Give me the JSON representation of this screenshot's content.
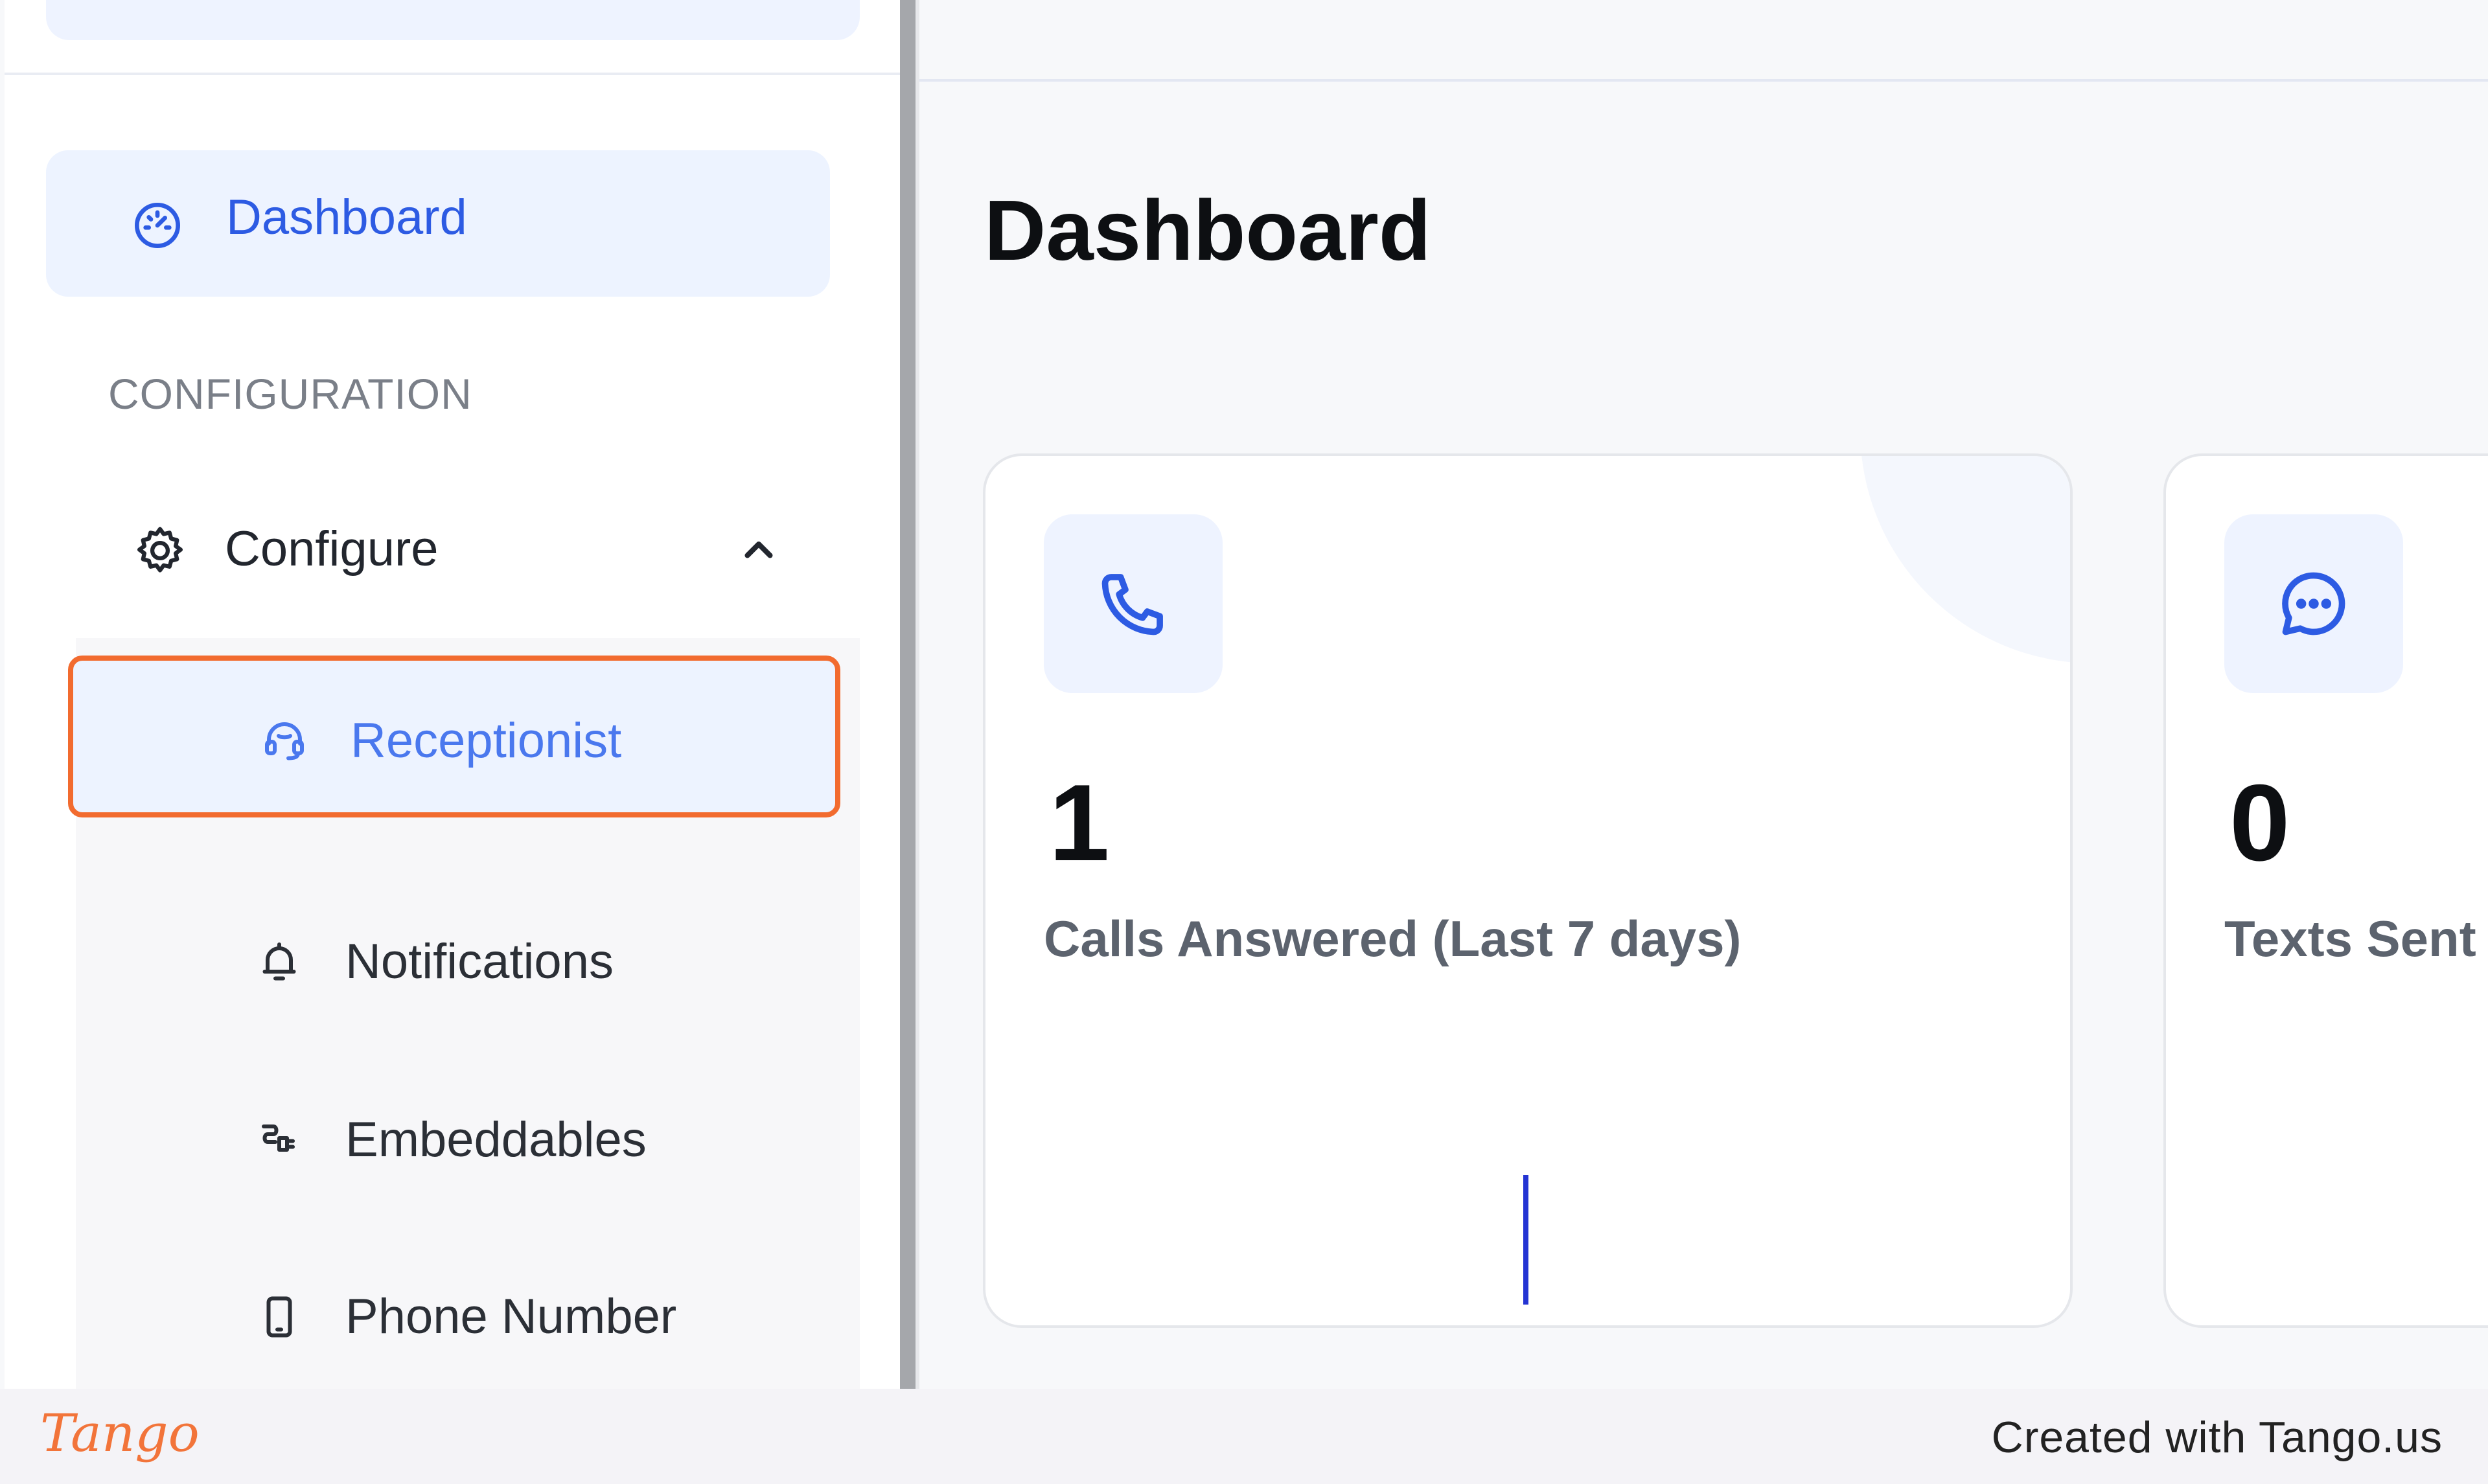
{
  "sidebar": {
    "dashboard_label": "Dashboard",
    "section_label": "CONFIGURATION",
    "configure": {
      "label": "Configure",
      "expanded": true
    },
    "submenu": [
      {
        "label": "Receptionist",
        "icon": "headset-icon",
        "active": true
      },
      {
        "label": "Notifications",
        "icon": "bell-icon",
        "active": false
      },
      {
        "label": "Embeddables",
        "icon": "plug-icon",
        "active": false
      },
      {
        "label": "Phone Number",
        "icon": "mobile-phone-icon",
        "active": false
      }
    ]
  },
  "main": {
    "title": "Dashboard",
    "cards": [
      {
        "icon": "phone-icon",
        "value": "1",
        "caption": "Calls Answered (Last 7 days)"
      },
      {
        "icon": "chat-bubble-icon",
        "value": "0",
        "caption": "Texts Sent ("
      }
    ]
  },
  "footer": {
    "brand": "Tango",
    "credit": "Created with Tango.us"
  },
  "colors": {
    "accent": "#2d5be3",
    "active_bg": "#edf3ff",
    "highlight_border": "#f26b2f"
  }
}
